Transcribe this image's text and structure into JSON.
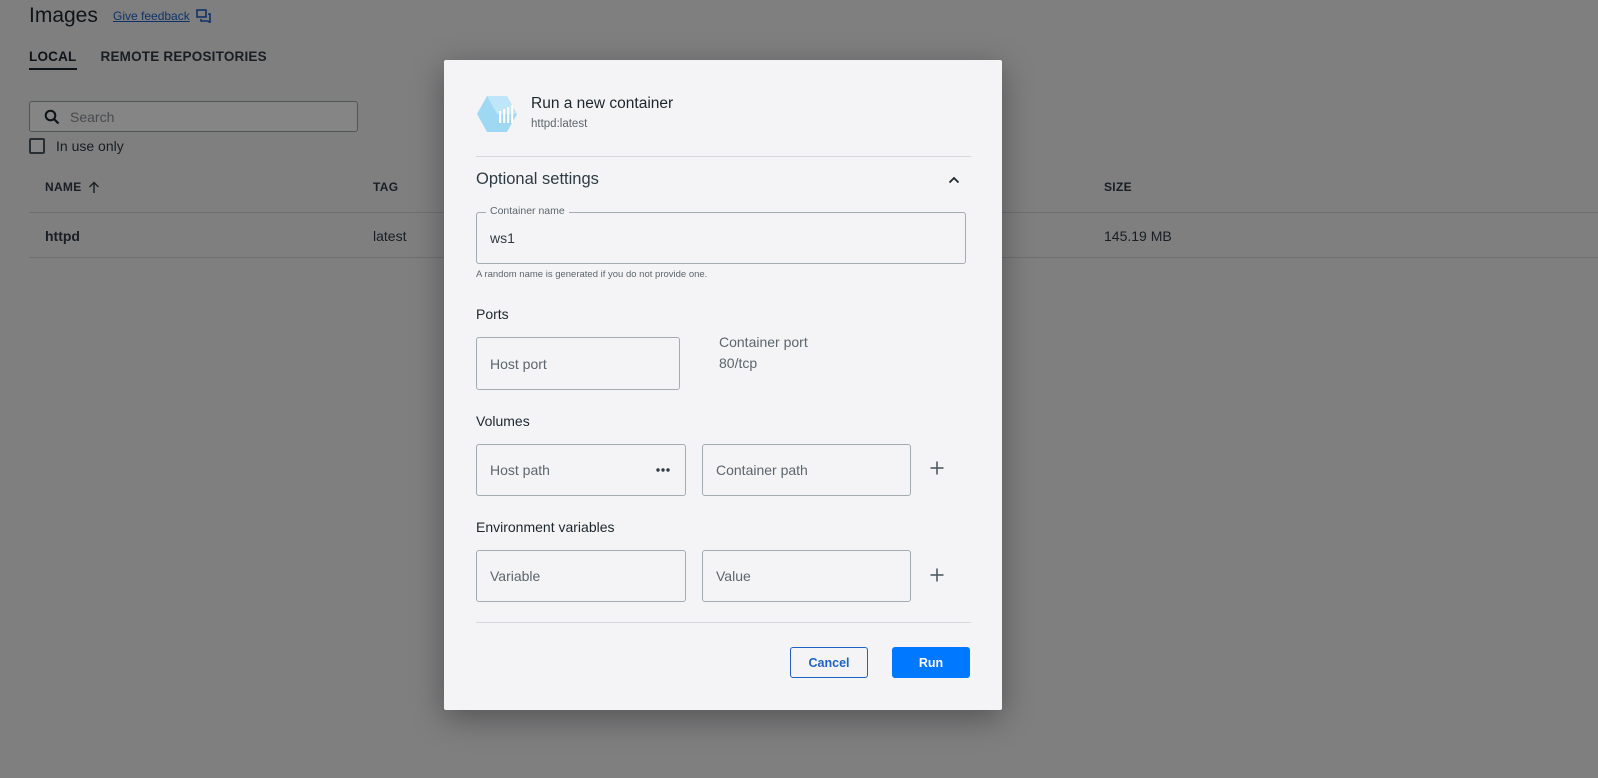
{
  "header": {
    "title": "Images",
    "feedback_link": "Give feedback"
  },
  "tabs": [
    {
      "label": "LOCAL",
      "active": true
    },
    {
      "label": "REMOTE REPOSITORIES",
      "active": false
    }
  ],
  "search": {
    "placeholder": "Search",
    "value": ""
  },
  "filter": {
    "in_use_label": "In use only",
    "checked": false
  },
  "table": {
    "columns": {
      "name": "NAME",
      "tag": "TAG",
      "size": "SIZE"
    },
    "rows": [
      {
        "name": "httpd",
        "tag": "latest",
        "size": "145.19 MB"
      }
    ]
  },
  "modal": {
    "title": "Run a new container",
    "subtitle": "httpd:latest",
    "optional_settings_label": "Optional settings",
    "container_name": {
      "legend": "Container name",
      "value": "ws1",
      "helper": "A random name is generated if you do not provide one."
    },
    "ports": {
      "label": "Ports",
      "host_port_placeholder": "Host port",
      "container_port_label": "Container port",
      "container_port_value": "80/tcp"
    },
    "volumes": {
      "label": "Volumes",
      "host_path_placeholder": "Host path",
      "container_path_placeholder": "Container path"
    },
    "env": {
      "label": "Environment variables",
      "variable_placeholder": "Variable",
      "value_placeholder": "Value"
    },
    "buttons": {
      "cancel": "Cancel",
      "run": "Run"
    }
  },
  "colors": {
    "accent": "#0078ff",
    "link": "#1d63c6",
    "docker_icon": "#9fd8f3"
  },
  "icons": [
    "feedback-icon",
    "search-icon",
    "docker-container-icon",
    "chevron-up-icon",
    "more-dots-icon",
    "plus-icon",
    "sort-arrow-up-icon"
  ]
}
